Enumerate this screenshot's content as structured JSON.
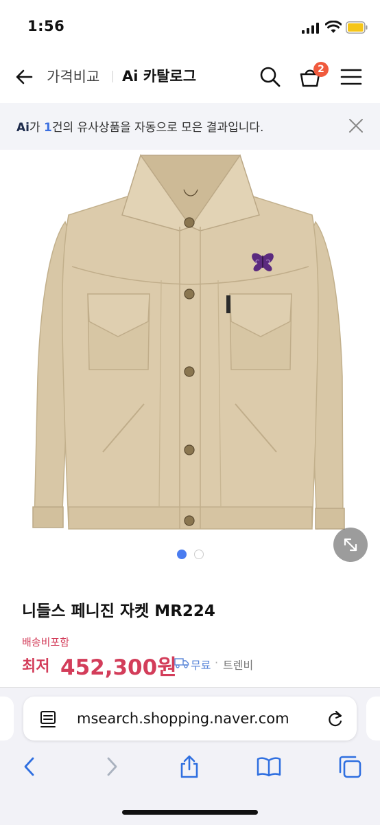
{
  "status_bar": {
    "time": "1:56"
  },
  "header": {
    "compare_label": "가격비교",
    "section_title": "Ai 카탈로그",
    "cart_count": "2"
  },
  "notice": {
    "ai_label": "Ai",
    "text_part1": "가 ",
    "count": "1",
    "text_part2": "건의 유사상품을 자동으로 모은 결과입니다."
  },
  "gallery": {
    "total_images": 2,
    "current_index": 1
  },
  "product": {
    "title": "니들스 페니진 자켓 MR224",
    "shipping_included": "배송비포함",
    "price_prefix": "최저",
    "price": "452,300원",
    "shipping": "무료",
    "separator": "·",
    "seller": "트렌비"
  },
  "browser": {
    "url": "msearch.shopping.naver.com"
  },
  "colors": {
    "accent_red": "#d33d5a",
    "accent_blue": "#4a7cf0",
    "badge": "#f05a3d"
  }
}
